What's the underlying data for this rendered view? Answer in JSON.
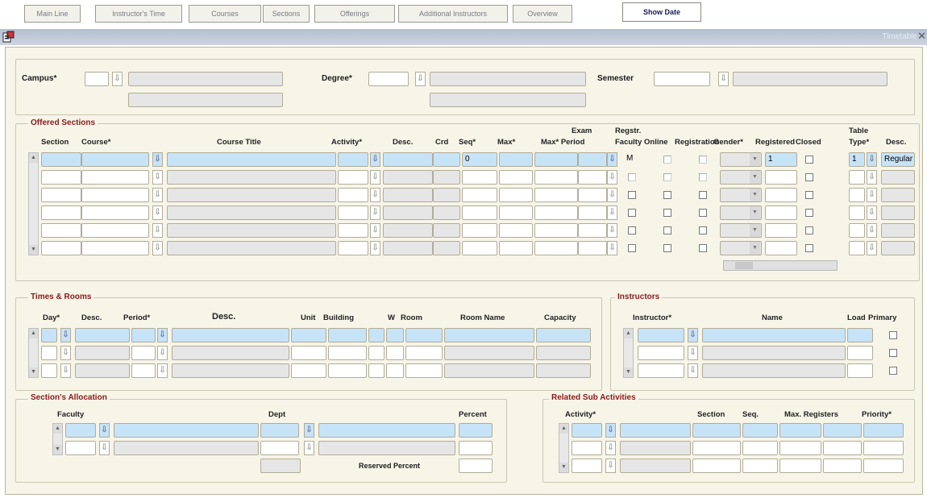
{
  "tabs": [
    "Main Line",
    "Instructor's Time",
    "Courses",
    "Sections",
    "Offerings",
    "Additional Instructors",
    "Overview"
  ],
  "show_date_label": "Show Date",
  "window": {
    "title": "Timetable"
  },
  "header": {
    "campus_label": "Campus*",
    "degree_label": "Degree*",
    "semester_label": "Semester"
  },
  "offered_sections": {
    "title": "Offered Sections",
    "headers": {
      "section": "Section",
      "course": "Course*",
      "course_title": "Course Title",
      "activity": "Activity*",
      "desc": "Desc.",
      "crd": "Crd",
      "seq": "Seq*",
      "max": "Max*",
      "exam_top": "Exam",
      "max_period": "Max* Period",
      "regstr_top": "Regstr.",
      "regstr_bottom": "Faculty",
      "online": "Online",
      "reg_open": "Registration",
      "gender": "Gender*",
      "registered": "Registered",
      "closed": "Closed",
      "table_top": "Table",
      "table_bottom": "Type*",
      "desc2": "Desc."
    },
    "row1": {
      "seq": "0",
      "regstr": "M",
      "registered": "1",
      "table_type": "1",
      "table_desc": "Regular"
    }
  },
  "times_rooms": {
    "title": "Times & Rooms",
    "headers": {
      "day": "Day*",
      "desc": "Desc.",
      "period": "Period*",
      "desc2": "Desc.",
      "unit": "Unit",
      "building": "Building",
      "w": "W",
      "room": "Room",
      "room_name": "Room Name",
      "capacity": "Capacity"
    }
  },
  "instructors": {
    "title": "Instructors",
    "headers": {
      "instructor": "Instructor*",
      "name": "Name",
      "load": "Load",
      "primary": "Primary"
    }
  },
  "allocation": {
    "title": "Section's Allocation",
    "headers": {
      "faculty": "Faculty",
      "dept": "Dept",
      "percent": "Percent"
    },
    "reserved_label": "Reserved Percent"
  },
  "subactivities": {
    "title": "Related Sub Activities",
    "headers": {
      "activity": "Activity*",
      "section": "Section",
      "seq": "Seq.",
      "max_registers": "Max. Registers",
      "priority": "Priority*"
    }
  }
}
